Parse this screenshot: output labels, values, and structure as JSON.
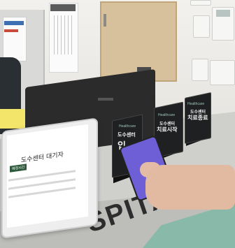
{
  "tablet": {
    "title": "도수센터 대기자",
    "logo_label": "예정시간"
  },
  "signs": [
    {
      "brand": "Healthcare",
      "line1": "도수센터",
      "line2": "입"
    },
    {
      "brand": "Healthcare",
      "line1": "도수센터",
      "line2": "치료시작"
    },
    {
      "brand": "Healthcare",
      "line1": "도수센터",
      "line2": "치료종료"
    }
  ],
  "counter": {
    "lettering": "SPITA"
  },
  "colors": {
    "phone_screen": "#6f5fd6",
    "tablet_header": "#2e5a3c",
    "green_panel": "#7fb8a6"
  }
}
